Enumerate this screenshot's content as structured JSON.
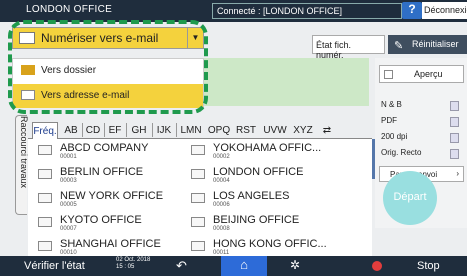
{
  "topbar": {
    "title": "LONDON OFFICE",
    "connected": "Connecté : [LONDON OFFICE]",
    "help": "?",
    "logout": "Déconnexion"
  },
  "mode": {
    "selected": "Numériser vers e-mail",
    "options": [
      "Vers dossier",
      "Vers adresse e-mail"
    ]
  },
  "toolbar": {
    "status": "État fich. numér.",
    "reset": "Réinitialiser"
  },
  "side_tab": "Raccourci travaux",
  "tabs": [
    "Fréq.",
    "AB",
    "CD",
    "EF",
    "GH",
    "IJK",
    "LMN",
    "OPQ",
    "RST",
    "UVW",
    "XYZ"
  ],
  "entries": [
    {
      "name": "ABCD COMPANY",
      "num": "00001"
    },
    {
      "name": "YOKOHAMA OFFIC...",
      "num": "00002"
    },
    {
      "name": "BERLIN OFFICE",
      "num": "00003"
    },
    {
      "name": "LONDON OFFICE",
      "num": "00004"
    },
    {
      "name": "NEW YORK OFFICE",
      "num": "00005"
    },
    {
      "name": "LOS ANGELES",
      "num": "00006"
    },
    {
      "name": "KYOTO OFFICE",
      "num": "00007"
    },
    {
      "name": "BEIJING OFFICE",
      "num": "00008"
    },
    {
      "name": "SHANGHAI  OFFICE",
      "num": "00010"
    },
    {
      "name": "HONG KONG OFFIC...",
      "num": "00011"
    }
  ],
  "settings": {
    "preview": "Aperçu",
    "color": "N & B",
    "format": "PDF",
    "resolution": "200 dpi",
    "side": "Orig. Recto",
    "param": "Param. envoi"
  },
  "start": "Départ",
  "bottom": {
    "check": "Vérifier l'état",
    "date": "02 Oct. 2018",
    "time": "15 : 05",
    "stop": "Stop"
  },
  "colors": {
    "accent": "#f4d23d",
    "highlight": "#1f9a4d",
    "dark": "#1f2d3d",
    "home": "#2d6bd8"
  }
}
